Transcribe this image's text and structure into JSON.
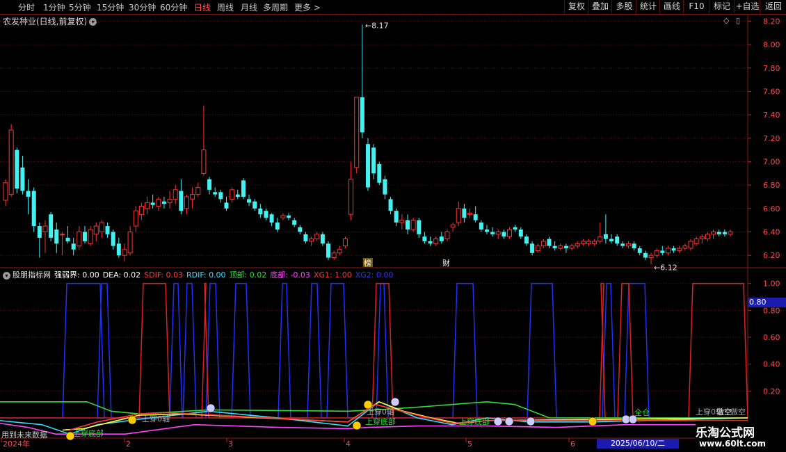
{
  "toolbar": {
    "periods": [
      "分时",
      "1分钟",
      "5分钟",
      "15分钟",
      "30分钟",
      "60分钟",
      "日线",
      "周线",
      "月线",
      "多周期",
      "更多 >"
    ],
    "active_period": "日线",
    "right_buttons": [
      "复权",
      "叠加",
      "多股",
      "统计",
      "画线",
      "F10",
      "标记",
      "+自选",
      "返回"
    ]
  },
  "stock": {
    "title": "农发种业(日线,前复权)",
    "high_label": "8.17",
    "low_label": "6.12",
    "markers": [
      "榜",
      "财"
    ]
  },
  "price_axis": {
    "ticks": [
      {
        "label": "8.20",
        "value": 8.2
      },
      {
        "label": "8.00",
        "value": 8.0
      },
      {
        "label": "7.80",
        "value": 7.8
      },
      {
        "label": "7.60",
        "value": 7.6
      },
      {
        "label": "7.40",
        "value": 7.4
      },
      {
        "label": "7.20",
        "value": 7.2
      },
      {
        "label": "7.00",
        "value": 7.0
      },
      {
        "label": "6.80",
        "value": 6.8
      },
      {
        "label": "6.60",
        "value": 6.6
      },
      {
        "label": "6.40",
        "value": 6.4
      },
      {
        "label": "6.20",
        "value": 6.2
      }
    ]
  },
  "indicator": {
    "name": "股朋指标网",
    "items": [
      {
        "text": "强弱界: 0.00",
        "color": "#ffffff"
      },
      {
        "text": "DEA: 0.02",
        "color": "#ffffff"
      },
      {
        "text": "SDIF: 0.03",
        "color": "#ff3b3b"
      },
      {
        "text": "RDIF: 0.00",
        "color": "#33e0ff"
      },
      {
        "text": "顶部: 0.02",
        "color": "#33dd33"
      },
      {
        "text": "底部: -0.03",
        "color": "#ff44ff"
      },
      {
        "text": "XG1: 1.00",
        "color": "#ff3333"
      },
      {
        "text": "XG2: 0.00",
        "color": "#3333ff"
      }
    ],
    "axis_ticks": [
      {
        "label": "1.00",
        "value": 1.0
      },
      {
        "label": "0.80",
        "value": 0.8
      },
      {
        "label": "0.60",
        "value": 0.6
      },
      {
        "label": "0.40",
        "value": 0.4
      },
      {
        "label": "0.20",
        "value": 0.2
      }
    ],
    "current_value_tag": "0.80",
    "signal_labels": [
      "上穿底部",
      "上穿0轴",
      "上穿底部",
      "上穿底部",
      "上穿0轴",
      "做空",
      "上穿0轴",
      "做空",
      "全仓"
    ],
    "footnote": "用到未来数据"
  },
  "date_axis": {
    "labels": [
      "2024年",
      "2",
      "3",
      "4",
      "5",
      "6"
    ],
    "cursor_date": "2025/06/10/二"
  },
  "watermark": {
    "title": "乐淘公式网",
    "url": "www.60lt.com"
  },
  "colors": {
    "up": "#ff3232",
    "down": "#44f0f0",
    "grid": "#5a0d0d",
    "xg1": "#e02020",
    "xg2": "#2030ff"
  },
  "chart_data": {
    "type": "candlestick",
    "title": "农发种业(日线,前复权)",
    "price_range": [
      6.1,
      8.25
    ],
    "candles": [
      {
        "o": 6.67,
        "h": 6.85,
        "l": 6.62,
        "c": 6.82
      },
      {
        "o": 6.72,
        "h": 7.32,
        "l": 6.7,
        "c": 7.27
      },
      {
        "o": 7.1,
        "h": 7.12,
        "l": 6.73,
        "c": 6.77
      },
      {
        "o": 6.95,
        "h": 7.05,
        "l": 6.72,
        "c": 6.75
      },
      {
        "o": 6.75,
        "h": 6.85,
        "l": 6.55,
        "c": 6.7
      },
      {
        "o": 6.75,
        "h": 6.78,
        "l": 6.4,
        "c": 6.45
      },
      {
        "o": 6.45,
        "h": 6.48,
        "l": 6.18,
        "c": 6.35
      },
      {
        "o": 6.4,
        "h": 6.5,
        "l": 6.22,
        "c": 6.45
      },
      {
        "o": 6.55,
        "h": 6.57,
        "l": 6.32,
        "c": 6.35
      },
      {
        "o": 6.42,
        "h": 6.48,
        "l": 6.22,
        "c": 6.3
      },
      {
        "o": 6.38,
        "h": 6.4,
        "l": 6.2,
        "c": 6.38
      },
      {
        "o": 6.35,
        "h": 6.45,
        "l": 6.3,
        "c": 6.32
      },
      {
        "o": 6.3,
        "h": 6.35,
        "l": 6.2,
        "c": 6.25
      },
      {
        "o": 6.28,
        "h": 6.45,
        "l": 6.25,
        "c": 6.4
      },
      {
        "o": 6.4,
        "h": 6.45,
        "l": 6.3,
        "c": 6.32
      },
      {
        "o": 6.3,
        "h": 6.45,
        "l": 6.28,
        "c": 6.42
      },
      {
        "o": 6.38,
        "h": 6.48,
        "l": 6.32,
        "c": 6.45
      },
      {
        "o": 6.4,
        "h": 6.5,
        "l": 6.35,
        "c": 6.48
      },
      {
        "o": 6.45,
        "h": 6.48,
        "l": 6.35,
        "c": 6.38
      },
      {
        "o": 6.4,
        "h": 6.42,
        "l": 6.25,
        "c": 6.28
      },
      {
        "o": 6.3,
        "h": 6.35,
        "l": 6.18,
        "c": 6.2
      },
      {
        "o": 6.2,
        "h": 6.3,
        "l": 6.15,
        "c": 6.25
      },
      {
        "o": 6.22,
        "h": 6.45,
        "l": 6.2,
        "c": 6.4
      },
      {
        "o": 6.45,
        "h": 6.62,
        "l": 6.4,
        "c": 6.58
      },
      {
        "o": 6.55,
        "h": 6.65,
        "l": 6.5,
        "c": 6.62
      },
      {
        "o": 6.6,
        "h": 6.7,
        "l": 6.55,
        "c": 6.65
      },
      {
        "o": 6.65,
        "h": 6.72,
        "l": 6.6,
        "c": 6.63
      },
      {
        "o": 6.62,
        "h": 6.7,
        "l": 6.58,
        "c": 6.68
      },
      {
        "o": 6.66,
        "h": 6.7,
        "l": 6.6,
        "c": 6.64
      },
      {
        "o": 6.65,
        "h": 6.75,
        "l": 6.6,
        "c": 6.68
      },
      {
        "o": 6.68,
        "h": 6.8,
        "l": 6.64,
        "c": 6.76
      },
      {
        "o": 6.75,
        "h": 6.85,
        "l": 6.55,
        "c": 6.58
      },
      {
        "o": 6.6,
        "h": 6.72,
        "l": 6.55,
        "c": 6.7
      },
      {
        "o": 6.68,
        "h": 6.78,
        "l": 6.6,
        "c": 6.72
      },
      {
        "o": 6.72,
        "h": 6.82,
        "l": 6.7,
        "c": 6.78
      },
      {
        "o": 6.9,
        "h": 7.48,
        "l": 6.88,
        "c": 7.1
      },
      {
        "o": 6.85,
        "h": 6.87,
        "l": 6.72,
        "c": 6.76
      },
      {
        "o": 6.74,
        "h": 6.78,
        "l": 6.7,
        "c": 6.72
      },
      {
        "o": 6.74,
        "h": 6.76,
        "l": 6.65,
        "c": 6.68
      },
      {
        "o": 6.65,
        "h": 6.7,
        "l": 6.58,
        "c": 6.6
      },
      {
        "o": 6.68,
        "h": 6.78,
        "l": 6.65,
        "c": 6.76
      },
      {
        "o": 6.72,
        "h": 6.76,
        "l": 6.68,
        "c": 6.7
      },
      {
        "o": 6.84,
        "h": 6.86,
        "l": 6.68,
        "c": 6.7
      },
      {
        "o": 6.68,
        "h": 6.72,
        "l": 6.62,
        "c": 6.65
      },
      {
        "o": 6.66,
        "h": 6.68,
        "l": 6.58,
        "c": 6.6
      },
      {
        "o": 6.6,
        "h": 6.64,
        "l": 6.52,
        "c": 6.55
      },
      {
        "o": 6.58,
        "h": 6.6,
        "l": 6.5,
        "c": 6.52
      },
      {
        "o": 6.55,
        "h": 6.56,
        "l": 6.45,
        "c": 6.48
      },
      {
        "o": 6.48,
        "h": 6.52,
        "l": 6.4,
        "c": 6.42
      },
      {
        "o": 6.52,
        "h": 6.56,
        "l": 6.5,
        "c": 6.54
      },
      {
        "o": 6.54,
        "h": 6.56,
        "l": 6.5,
        "c": 6.52
      },
      {
        "o": 6.5,
        "h": 6.52,
        "l": 6.44,
        "c": 6.46
      },
      {
        "o": 6.44,
        "h": 6.46,
        "l": 6.38,
        "c": 6.4
      },
      {
        "o": 6.38,
        "h": 6.4,
        "l": 6.3,
        "c": 6.32
      },
      {
        "o": 6.32,
        "h": 6.36,
        "l": 6.28,
        "c": 6.34
      },
      {
        "o": 6.34,
        "h": 6.4,
        "l": 6.32,
        "c": 6.38
      },
      {
        "o": 6.38,
        "h": 6.4,
        "l": 6.28,
        "c": 6.3
      },
      {
        "o": 6.3,
        "h": 6.32,
        "l": 6.16,
        "c": 6.18
      },
      {
        "o": 6.18,
        "h": 6.24,
        "l": 6.16,
        "c": 6.22
      },
      {
        "o": 6.22,
        "h": 6.28,
        "l": 6.2,
        "c": 6.25
      },
      {
        "o": 6.28,
        "h": 6.36,
        "l": 6.26,
        "c": 6.34
      },
      {
        "o": 6.55,
        "h": 7.0,
        "l": 6.5,
        "c": 6.85
      },
      {
        "o": 6.95,
        "h": 7.55,
        "l": 6.9,
        "c": 7.55
      },
      {
        "o": 7.55,
        "h": 8.17,
        "l": 7.2,
        "c": 7.25
      },
      {
        "o": 7.15,
        "h": 7.2,
        "l": 6.75,
        "c": 6.78
      },
      {
        "o": 7.12,
        "h": 7.15,
        "l": 6.85,
        "c": 6.9
      },
      {
        "o": 6.98,
        "h": 7.0,
        "l": 6.8,
        "c": 6.82
      },
      {
        "o": 6.85,
        "h": 6.88,
        "l": 6.68,
        "c": 6.72
      },
      {
        "o": 6.68,
        "h": 6.7,
        "l": 6.55,
        "c": 6.58
      },
      {
        "o": 6.58,
        "h": 6.6,
        "l": 6.45,
        "c": 6.48
      },
      {
        "o": 6.48,
        "h": 6.55,
        "l": 6.42,
        "c": 6.5
      },
      {
        "o": 6.5,
        "h": 6.55,
        "l": 6.38,
        "c": 6.42
      },
      {
        "o": 6.42,
        "h": 6.52,
        "l": 6.4,
        "c": 6.5
      },
      {
        "o": 6.5,
        "h": 6.52,
        "l": 6.35,
        "c": 6.38
      },
      {
        "o": 6.36,
        "h": 6.4,
        "l": 6.3,
        "c": 6.32
      },
      {
        "o": 6.32,
        "h": 6.36,
        "l": 6.28,
        "c": 6.3
      },
      {
        "o": 6.3,
        "h": 6.36,
        "l": 6.28,
        "c": 6.34
      },
      {
        "o": 6.36,
        "h": 6.4,
        "l": 6.3,
        "c": 6.32
      },
      {
        "o": 6.34,
        "h": 6.42,
        "l": 6.32,
        "c": 6.4
      },
      {
        "o": 6.44,
        "h": 6.48,
        "l": 6.4,
        "c": 6.46
      },
      {
        "o": 6.48,
        "h": 6.66,
        "l": 6.45,
        "c": 6.6
      },
      {
        "o": 6.6,
        "h": 6.64,
        "l": 6.48,
        "c": 6.52
      },
      {
        "o": 6.55,
        "h": 6.6,
        "l": 6.52,
        "c": 6.56
      },
      {
        "o": 6.55,
        "h": 6.62,
        "l": 6.48,
        "c": 6.5
      },
      {
        "o": 6.48,
        "h": 6.5,
        "l": 6.4,
        "c": 6.42
      },
      {
        "o": 6.42,
        "h": 6.46,
        "l": 6.38,
        "c": 6.4
      },
      {
        "o": 6.4,
        "h": 6.44,
        "l": 6.36,
        "c": 6.38
      },
      {
        "o": 6.38,
        "h": 6.42,
        "l": 6.34,
        "c": 6.4
      },
      {
        "o": 6.4,
        "h": 6.42,
        "l": 6.34,
        "c": 6.36
      },
      {
        "o": 6.36,
        "h": 6.44,
        "l": 6.34,
        "c": 6.42
      },
      {
        "o": 6.44,
        "h": 6.46,
        "l": 6.4,
        "c": 6.42
      },
      {
        "o": 6.42,
        "h": 6.44,
        "l": 6.34,
        "c": 6.36
      },
      {
        "o": 6.36,
        "h": 6.38,
        "l": 6.28,
        "c": 6.3
      },
      {
        "o": 6.3,
        "h": 6.32,
        "l": 6.2,
        "c": 6.22
      },
      {
        "o": 6.24,
        "h": 6.3,
        "l": 6.22,
        "c": 6.28
      },
      {
        "o": 6.28,
        "h": 6.34,
        "l": 6.26,
        "c": 6.32
      },
      {
        "o": 6.34,
        "h": 6.36,
        "l": 6.26,
        "c": 6.28
      },
      {
        "o": 6.28,
        "h": 6.32,
        "l": 6.24,
        "c": 6.26
      },
      {
        "o": 6.26,
        "h": 6.3,
        "l": 6.24,
        "c": 6.28
      },
      {
        "o": 6.28,
        "h": 6.3,
        "l": 6.22,
        "c": 6.26
      },
      {
        "o": 6.26,
        "h": 6.3,
        "l": 6.24,
        "c": 6.28
      },
      {
        "o": 6.28,
        "h": 6.32,
        "l": 6.26,
        "c": 6.3
      },
      {
        "o": 6.3,
        "h": 6.34,
        "l": 6.28,
        "c": 6.32
      },
      {
        "o": 6.3,
        "h": 6.34,
        "l": 6.28,
        "c": 6.32
      },
      {
        "o": 6.3,
        "h": 6.34,
        "l": 6.28,
        "c": 6.32
      },
      {
        "o": 6.32,
        "h": 6.48,
        "l": 6.3,
        "c": 6.36
      },
      {
        "o": 6.38,
        "h": 6.55,
        "l": 6.3,
        "c": 6.34
      },
      {
        "o": 6.34,
        "h": 6.38,
        "l": 6.3,
        "c": 6.32
      },
      {
        "o": 6.36,
        "h": 6.38,
        "l": 6.28,
        "c": 6.3
      },
      {
        "o": 6.3,
        "h": 6.32,
        "l": 6.26,
        "c": 6.28
      },
      {
        "o": 6.28,
        "h": 6.32,
        "l": 6.26,
        "c": 6.3
      },
      {
        "o": 6.3,
        "h": 6.32,
        "l": 6.24,
        "c": 6.26
      },
      {
        "o": 6.26,
        "h": 6.28,
        "l": 6.2,
        "c": 6.22
      },
      {
        "o": 6.22,
        "h": 6.24,
        "l": 6.16,
        "c": 6.18
      },
      {
        "o": 6.18,
        "h": 6.22,
        "l": 6.12,
        "c": 6.2
      },
      {
        "o": 6.2,
        "h": 6.26,
        "l": 6.18,
        "c": 6.24
      },
      {
        "o": 6.24,
        "h": 6.28,
        "l": 6.2,
        "c": 6.22
      },
      {
        "o": 6.22,
        "h": 6.28,
        "l": 6.2,
        "c": 6.26
      },
      {
        "o": 6.26,
        "h": 6.28,
        "l": 6.22,
        "c": 6.24
      },
      {
        "o": 6.24,
        "h": 6.28,
        "l": 6.22,
        "c": 6.26
      },
      {
        "o": 6.26,
        "h": 6.3,
        "l": 6.24,
        "c": 6.28
      },
      {
        "o": 6.26,
        "h": 6.34,
        "l": 6.24,
        "c": 6.32
      },
      {
        "o": 6.3,
        "h": 6.36,
        "l": 6.28,
        "c": 6.34
      },
      {
        "o": 6.34,
        "h": 6.38,
        "l": 6.3,
        "c": 6.36
      },
      {
        "o": 6.34,
        "h": 6.4,
        "l": 6.32,
        "c": 6.38
      },
      {
        "o": 6.38,
        "h": 6.42,
        "l": 6.34,
        "c": 6.4
      },
      {
        "o": 6.4,
        "h": 6.42,
        "l": 6.36,
        "c": 6.38
      },
      {
        "o": 6.4,
        "h": 6.42,
        "l": 6.36,
        "c": 6.38
      },
      {
        "o": 6.38,
        "h": 6.42,
        "l": 6.36,
        "c": 6.4
      }
    ],
    "indicator_series": {
      "range": [
        -0.15,
        1.05
      ],
      "XG1": [
        0,
        0,
        0,
        0,
        0,
        0,
        0,
        0,
        0,
        0,
        0,
        0,
        0,
        0,
        0,
        0,
        0,
        0,
        0,
        0,
        0,
        0,
        0,
        0,
        0,
        0,
        0,
        0,
        0,
        0,
        0,
        0,
        0,
        0,
        0,
        0,
        0,
        0,
        0,
        0,
        0,
        0,
        0,
        0,
        0,
        0,
        0,
        0,
        0,
        0,
        0,
        0,
        0,
        0,
        0,
        0,
        0,
        0,
        0,
        0,
        0,
        0,
        0,
        0,
        0,
        0,
        0,
        0,
        0,
        0,
        0,
        0,
        0,
        0,
        0,
        0,
        0,
        0,
        0,
        0,
        0,
        0,
        0,
        0,
        0,
        0,
        0,
        0,
        0,
        0,
        0,
        0,
        0,
        0,
        0,
        0,
        0,
        0,
        0,
        0,
        0,
        0,
        0,
        0,
        0,
        0,
        0,
        0,
        0,
        0,
        0,
        0,
        0,
        0,
        0,
        0,
        0,
        0,
        0,
        0,
        0,
        0,
        0,
        0,
        0,
        0,
        0,
        0,
        0,
        0,
        0,
        1,
        1,
        1,
        1,
        1
      ],
      "XG2": [
        0,
        0,
        0,
        0,
        0,
        0,
        0,
        0,
        0,
        0,
        0,
        0,
        0,
        0,
        0,
        0,
        0,
        0,
        0,
        0,
        0,
        0,
        0,
        0,
        0,
        0,
        0,
        0,
        0,
        0,
        0,
        0,
        0,
        0,
        0,
        0,
        0,
        0,
        0,
        0,
        0,
        0,
        0,
        0,
        0,
        0,
        0,
        0,
        0,
        0,
        0,
        0,
        0,
        0,
        0,
        0,
        0,
        0,
        0,
        0,
        0,
        0,
        0,
        0,
        0,
        0,
        0,
        0,
        0,
        0,
        0,
        0,
        0,
        0,
        0,
        0,
        0,
        0,
        0,
        0,
        0,
        0,
        0,
        0,
        0,
        0,
        0,
        0,
        0,
        0,
        0,
        0,
        0,
        0,
        0,
        0,
        0,
        0,
        0,
        0,
        0,
        0,
        0,
        0,
        0,
        0,
        0,
        0,
        0,
        0,
        0,
        0,
        0,
        0,
        0,
        0,
        0,
        0,
        0,
        0,
        0,
        0,
        0,
        0,
        0,
        0,
        0,
        0,
        0,
        0,
        0,
        0,
        0,
        0,
        0,
        0
      ]
    }
  }
}
